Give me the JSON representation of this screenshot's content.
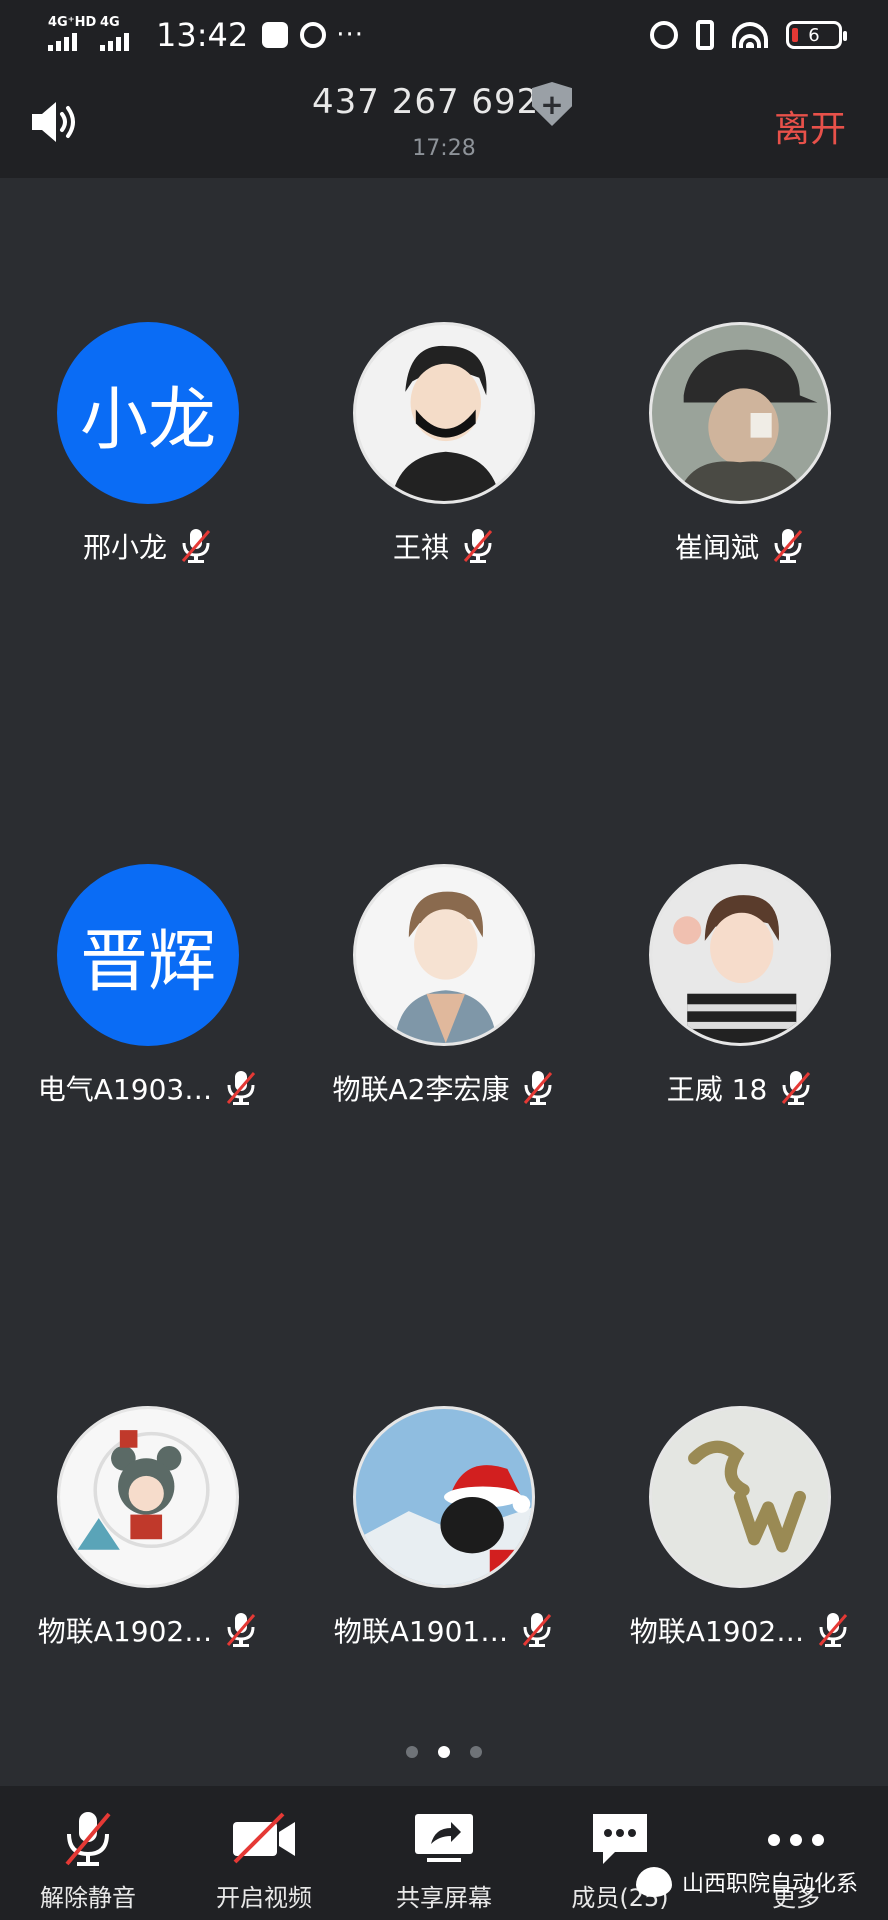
{
  "status_bar": {
    "network1": "4G⁺HD",
    "network2": "4G",
    "time": "13:42",
    "battery": "6"
  },
  "header": {
    "meeting_id": "437 267 692",
    "duration": "17:28",
    "leave_label": "离开",
    "shield_glyph": "+"
  },
  "participants": [
    {
      "name": "邢小龙",
      "avatar_text": "小龙",
      "avatar": "text",
      "muted": true
    },
    {
      "name": "王祺",
      "avatar": "masked-boy-icon",
      "muted": true
    },
    {
      "name": "崔闻斌",
      "avatar": "cap-man-icon",
      "muted": true
    },
    {
      "name": "电气A1903…",
      "avatar_text": "晋辉",
      "avatar": "text",
      "muted": true
    },
    {
      "name": "物联A2李宏康",
      "avatar": "anime-boy-icon",
      "muted": true
    },
    {
      "name": "王威  18",
      "avatar": "striped-boy-icon",
      "muted": true
    },
    {
      "name": "物联A1902…",
      "avatar": "bear-hood-icon",
      "muted": true
    },
    {
      "name": "物联A1901…",
      "avatar": "santa-hat-icon",
      "muted": true
    },
    {
      "name": "物联A1902…",
      "avatar": "sand-letters-icon",
      "muted": true
    }
  ],
  "pager": {
    "pages": 3,
    "active": 2
  },
  "toolbar": {
    "unmute": "解除静音",
    "start_video": "开启视频",
    "share_screen": "共享屏幕",
    "members": "成员(25)",
    "more": "更多"
  },
  "watermark": "山西职院自动化系",
  "colors": {
    "background": "#2b2d31",
    "bar": "#202124",
    "accent_blue": "#0a6cf5",
    "leave_red": "#e8514a",
    "mute_red": "#e53935"
  }
}
